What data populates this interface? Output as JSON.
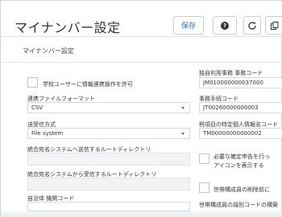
{
  "header": {
    "title": "マイナンバー設定",
    "save_label": "保存",
    "help_glyph": "?",
    "refresh_glyph": "↻",
    "copy_glyph": "⧉"
  },
  "subtitle": "マイナンバー設定",
  "left": {
    "school_checkbox_label": "学校ユーザーに情報連携操作を許可",
    "file_format_label": "連携ファイルフォーマット",
    "file_format_value": "CSV",
    "send_method_label": "送受信方式",
    "send_method_value": "File system",
    "send_root_label": "統合宛名システムへ送信するルートディレクトリ",
    "send_root_value": "",
    "receive_root_label": "統合宛名システムから受信するルートディレクトリ",
    "receive_root_value": "",
    "org_code_label": "自治体 機関コード"
  },
  "right": {
    "office_code_label": "独自利用事務 事務コード",
    "office_code_value": "JM010000000037000",
    "procedure_code_label": "事務手続コード",
    "procedure_code_value": "JT00260000000003",
    "tax_item_label": "税項目の特定個人情報名コード",
    "tax_item_value": "TM00000000000002",
    "confirm_checkbox_label_1": "必要な確定申告を行っ",
    "confirm_checkbox_label_2": "アイコンを表示する",
    "household_checkbox_label": "世帯構成員の削除前に",
    "household_code_label": "世帯構成員の識別コードの構築"
  }
}
